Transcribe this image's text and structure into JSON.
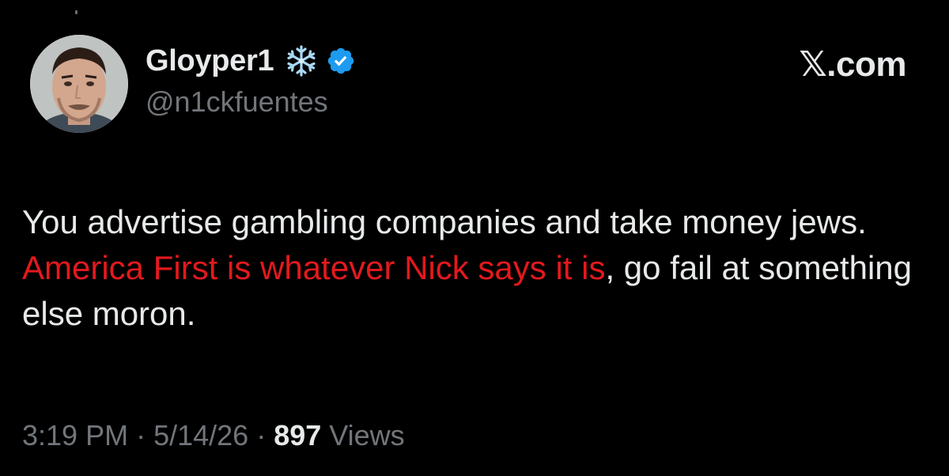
{
  "author": {
    "display_name": "Gloyper1",
    "handle": "@n1ckfuentes",
    "badge_icon": "snowflake-icon",
    "verified_icon": "verified-badge-icon",
    "verified_color": "#1d9bf0"
  },
  "site": {
    "label": "𝕏.com"
  },
  "tweet": {
    "text_part1": "You advertise gambling companies and take money jews. ",
    "text_highlight": "America First is whatever Nick says it is",
    "text_part2": ", go fail at something else moron.",
    "highlight_color": "#e3191d"
  },
  "meta": {
    "time": "3:19 PM",
    "separator1": " · ",
    "date": "5/14/26",
    "separator2": " · ",
    "views_count": "897",
    "views_label": " Views"
  }
}
